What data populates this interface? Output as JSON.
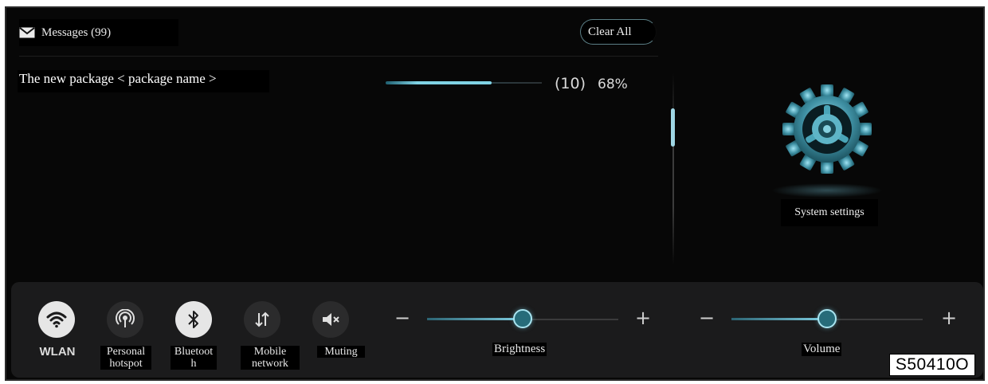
{
  "messages": {
    "title": "Messages (99)",
    "clear_all_label": "Clear All",
    "item": {
      "text": "The new package < package name >",
      "progress_count": "(10)",
      "progress_percent_label": "68%",
      "progress_value": 0.68
    }
  },
  "settings": {
    "label": "System settings",
    "icon": "gear-icon"
  },
  "quick_settings": {
    "toggles": [
      {
        "label": "WLAN",
        "icon": "wifi-icon",
        "state": "on"
      },
      {
        "label": "Personal\nhotspot",
        "icon": "hotspot-icon",
        "state": "off"
      },
      {
        "label": "Bluetoot\nh",
        "icon": "bluetooth-icon",
        "state": "on"
      },
      {
        "label": "Mobile\nnetwork",
        "icon": "mobile-data-icon",
        "state": "off"
      },
      {
        "label": "Muting",
        "icon": "mute-icon",
        "state": "off"
      }
    ],
    "brightness": {
      "label": "Brightness",
      "minus": "−",
      "plus": "+",
      "value": 0.5
    },
    "volume": {
      "label": "Volume",
      "minus": "−",
      "plus": "+",
      "value": 0.5
    }
  },
  "image_code": "S50410O",
  "colors": {
    "accent": "#7fd2e4",
    "background": "#070707",
    "bar": "#1b1b1c"
  }
}
